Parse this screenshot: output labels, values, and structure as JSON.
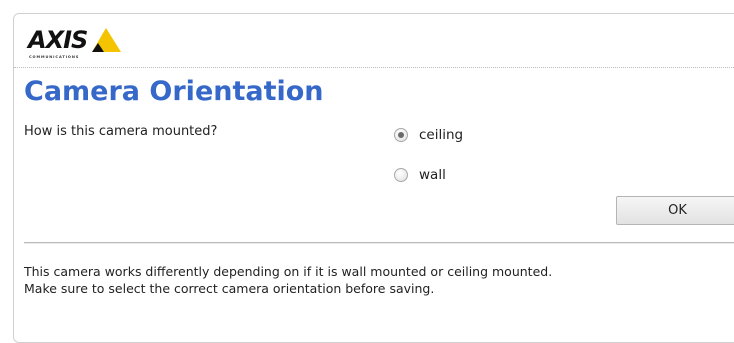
{
  "brand": {
    "logo_word": "AXIS",
    "logo_sub": "COMMUNICATIONS",
    "colors": {
      "triangle": "#f5c400",
      "text": "#111111"
    }
  },
  "page": {
    "title": "Camera Orientation",
    "title_color": "#3568c8"
  },
  "form": {
    "question": "How is this camera mounted?",
    "options": [
      {
        "label": "ceiling",
        "selected": true
      },
      {
        "label": "wall",
        "selected": false
      }
    ],
    "ok_label": "OK"
  },
  "info": {
    "line1": "This camera works differently depending on if it is wall mounted or ceiling mounted.",
    "line2": "Make sure to select the correct camera orientation before saving."
  }
}
